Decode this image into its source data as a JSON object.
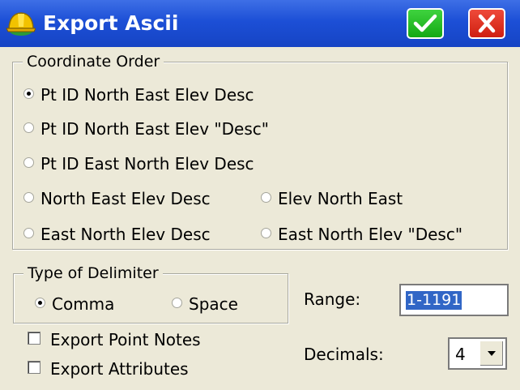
{
  "window": {
    "title": "Export Ascii",
    "ok_icon": "checkmark-icon",
    "close_icon": "x-icon",
    "accent": "#1c4fd6"
  },
  "coordinate_order": {
    "legend": "Coordinate Order",
    "options": [
      {
        "label": "Pt ID North East Elev Desc",
        "checked": true
      },
      {
        "label": "Pt ID North East Elev \"Desc\"",
        "checked": false
      },
      {
        "label": "Pt ID East North Elev Desc",
        "checked": false
      },
      {
        "label": "North East Elev Desc",
        "checked": false
      },
      {
        "label": "Elev North East",
        "checked": false
      },
      {
        "label": "East North Elev Desc",
        "checked": false
      },
      {
        "label": "East North Elev \"Desc\"",
        "checked": false
      }
    ]
  },
  "delimiter": {
    "legend": "Type of Delimiter",
    "options": [
      {
        "label": "Comma",
        "checked": true
      },
      {
        "label": "Space",
        "checked": false
      }
    ]
  },
  "range": {
    "label": "Range:",
    "value": "1-1191"
  },
  "checkboxes": [
    {
      "label": "Export Point Notes",
      "checked": false
    },
    {
      "label": "Export Attributes",
      "checked": false
    }
  ],
  "decimals": {
    "label": "Decimals:",
    "value": "4"
  }
}
